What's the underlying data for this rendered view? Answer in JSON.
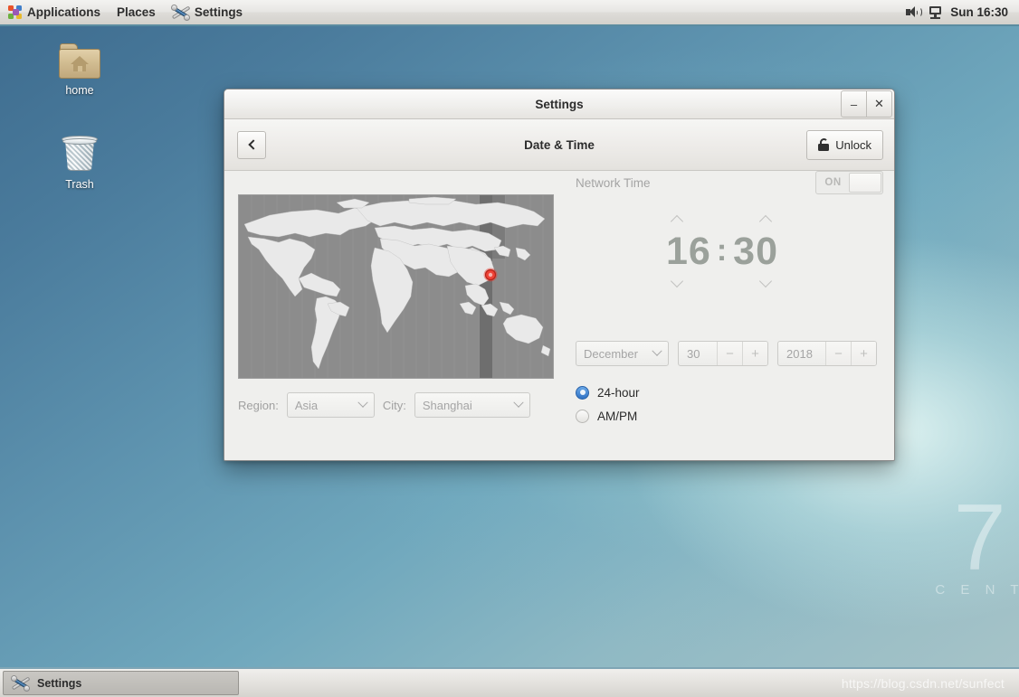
{
  "panel": {
    "applications_label": "Applications",
    "places_label": "Places",
    "settings_label": "Settings",
    "applications_icon": "apps-grid-icon",
    "settings_icon": "tools-icon",
    "volume_icon": "speaker-icon",
    "network_icon": "monitor-icon",
    "clock": "Sun 16:30"
  },
  "desktop": {
    "icons": [
      {
        "label": "home",
        "icon": "home-folder-icon"
      },
      {
        "label": "Trash",
        "icon": "trash-can-icon"
      }
    ],
    "brand": {
      "number": "7",
      "word": "C E N T"
    }
  },
  "window": {
    "title": "Settings",
    "minimize_label": "–",
    "close_label": "✕",
    "header": {
      "back_icon": "chevron-left-icon",
      "title": "Date & Time",
      "unlock_label": "Unlock",
      "unlock_icon": "open-padlock-icon"
    },
    "map": {
      "marker_icon": "location-marker-icon",
      "marker_color": "#e8392e",
      "land_color": "#e9e9e9",
      "ocean_color": "#8c8c8c",
      "highlight_color": "#6e6e6e"
    },
    "timezone": {
      "region_label": "Region:",
      "region_value": "Asia",
      "city_label": "City:",
      "city_value": "Shanghai"
    },
    "network_time": {
      "label": "Network Time",
      "toggle_state": "ON"
    },
    "clock": {
      "hours": "16",
      "separator": ":",
      "minutes": "30",
      "up_icon": "chevron-up-icon",
      "down_icon": "chevron-down-icon"
    },
    "date": {
      "month": "December",
      "day": "30",
      "year": "2018",
      "minus_label": "−",
      "plus_label": "+"
    },
    "time_format": {
      "option_24h": "24-hour",
      "option_ampm": "AM/PM",
      "selected": "24-hour"
    }
  },
  "taskbar": {
    "task_label": "Settings",
    "task_icon": "tools-icon",
    "watermark": "https://blog.csdn.net/sunfect"
  }
}
